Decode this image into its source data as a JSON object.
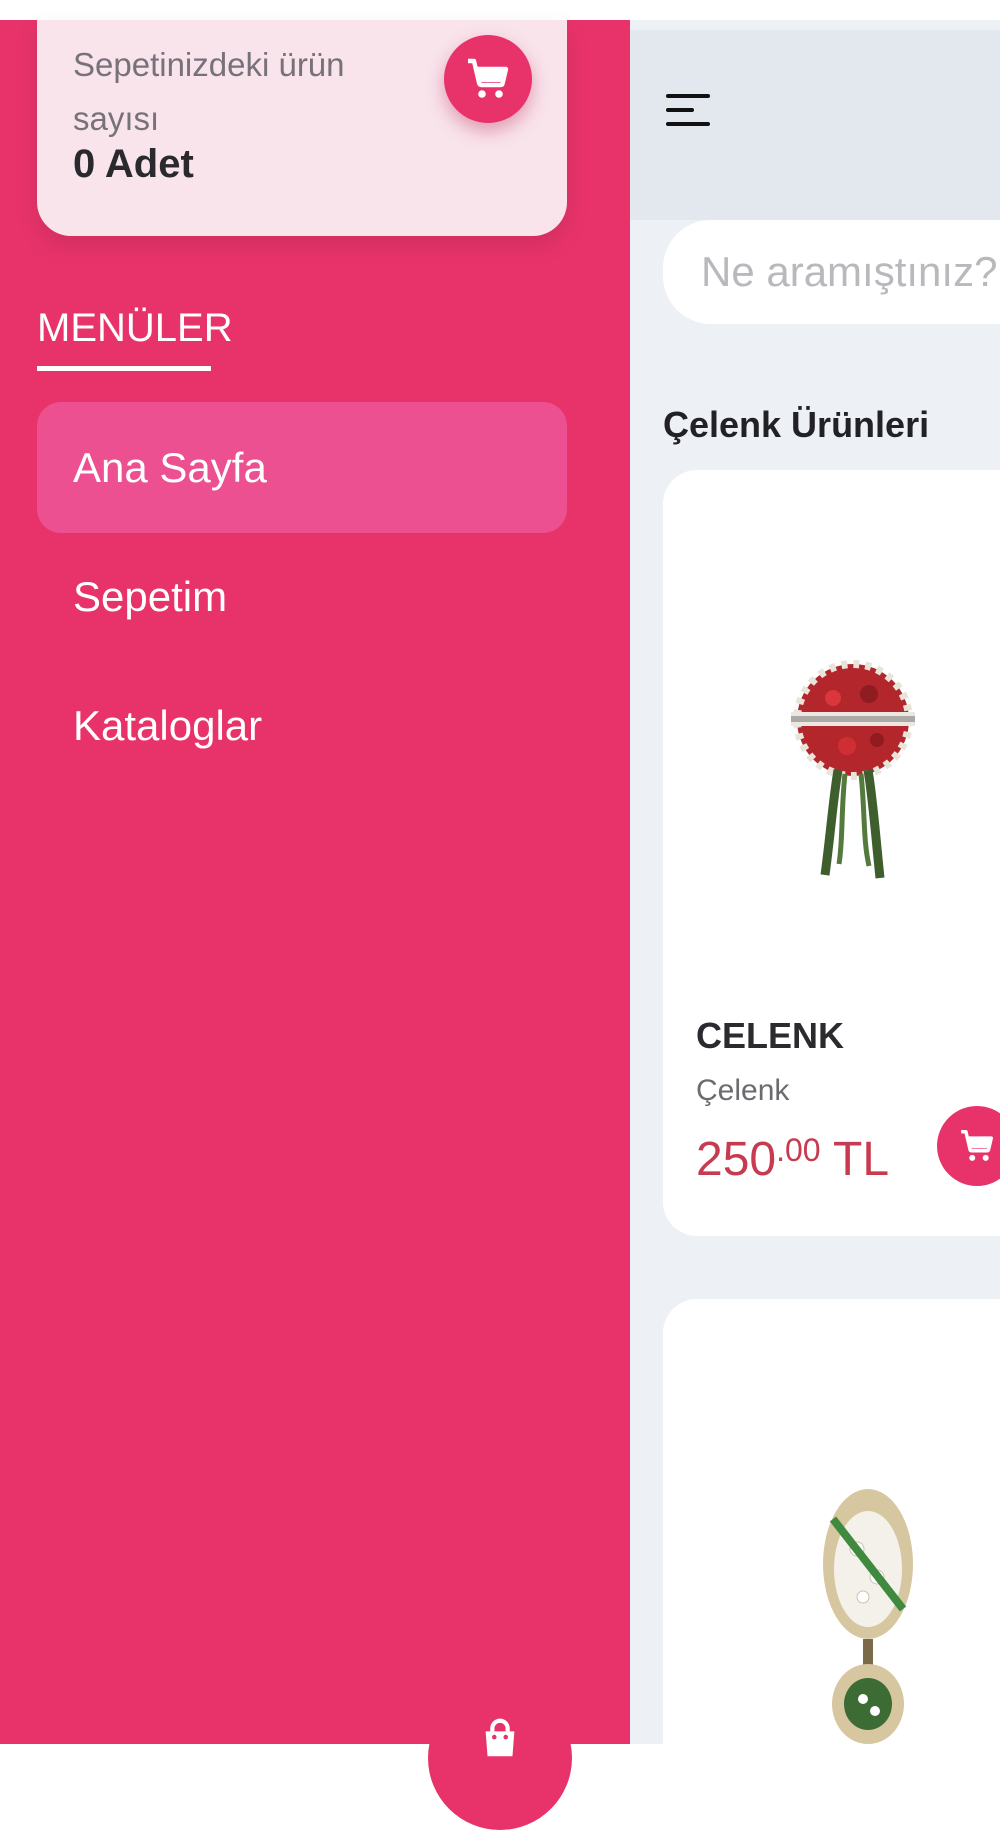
{
  "drawer": {
    "cart_summary": {
      "label": "Sepetinizdeki ürün sayısı",
      "count": "0 Adet",
      "icon": "cart-icon"
    },
    "menu_heading": "MENÜLER",
    "items": [
      {
        "label": "Ana Sayfa",
        "active": true
      },
      {
        "label": "Sepetim",
        "active": false
      },
      {
        "label": "Kataloglar",
        "active": false
      }
    ]
  },
  "main": {
    "search": {
      "placeholder": "Ne aramıştınız?"
    },
    "section_title": "Çelenk Ürünleri",
    "products": [
      {
        "name": "CELENK",
        "category": "Çelenk",
        "price_whole": "250",
        "price_cents": ".00",
        "currency": "TL"
      }
    ]
  },
  "colors": {
    "brand": "#e8336a",
    "drawer_active": "#ec5090",
    "cart_card": "#f9e4ec",
    "price": "#c73a4f",
    "page_bg": "#edf0f5"
  }
}
